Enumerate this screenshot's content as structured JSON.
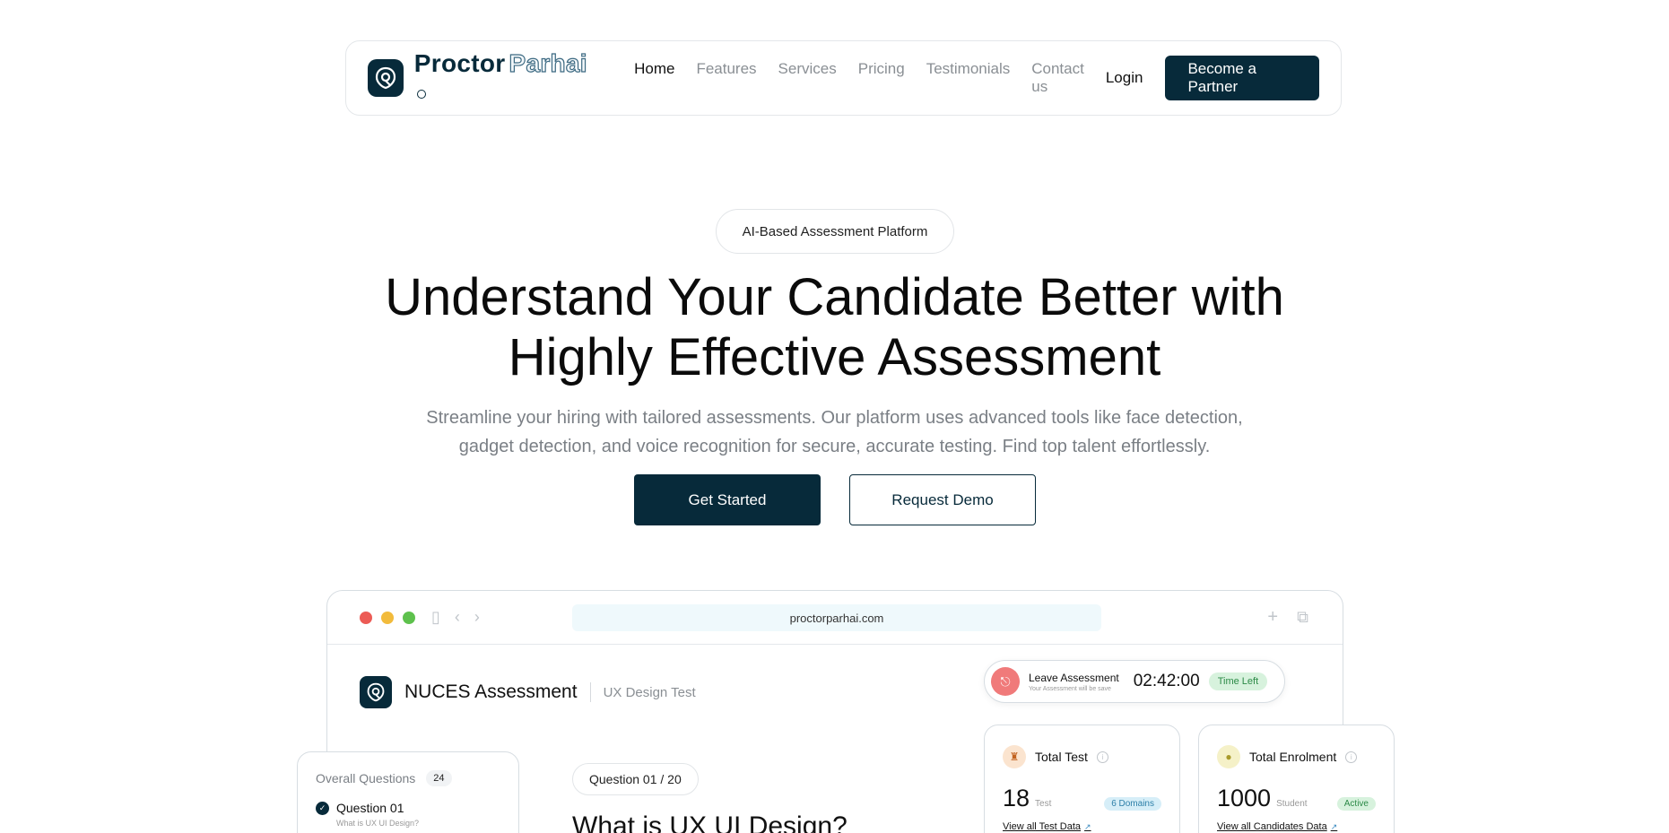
{
  "brand": {
    "name_dark": "Proctor",
    "name_light": "Parhai"
  },
  "nav": {
    "links": [
      "Home",
      "Features",
      "Services",
      "Pricing",
      "Testimonials",
      "Contact us"
    ],
    "login": "Login",
    "partner_button": "Become a Partner"
  },
  "hero": {
    "badge": "AI-Based Assessment Platform",
    "title_line1": "Understand Your Candidate Better with",
    "title_line2": "Highly Effective Assessment",
    "subtitle_line1": "Streamline your hiring with tailored assessments. Our platform uses advanced tools like face detection,",
    "subtitle_line2": "gadget detection, and voice recognition for secure, accurate testing. Find top talent effortlessly.",
    "primary_button": "Get Started",
    "secondary_button": "Request Demo"
  },
  "browser": {
    "url": "proctorparhai.com",
    "dot_colors": [
      "#ec5b55",
      "#f2bb3c",
      "#5ec14d"
    ]
  },
  "app": {
    "title": "NUCES Assessment",
    "subtitle": "UX Design Test",
    "question_pill": "Question 01 / 20",
    "question_title": "What is UX UI Design?"
  },
  "overall": {
    "label": "Overall Questions",
    "count": "24",
    "item_label": "Question 01",
    "item_sub": "What is UX UI Design?"
  },
  "timer": {
    "leave_label": "Leave Assessment",
    "leave_sub": "Your Assessment will be save",
    "time": "02:42:00",
    "time_left": "Time Left"
  },
  "stats": [
    {
      "title": "Total Test",
      "value": "18",
      "unit": "Test",
      "tag": "6 Domains",
      "link": "View all Test Data",
      "icon": "trophy-icon",
      "icon_bg": "#fbe4cf",
      "tag_bg": "#d6eef8",
      "tag_color": "#2d7fa8"
    },
    {
      "title": "Total Enrolment",
      "value": "1000",
      "unit": "Student",
      "tag": "Active",
      "link": "View all Candidates Data",
      "icon": "user-icon",
      "icon_bg": "#f5f1c8",
      "tag_bg": "#d7f2dd",
      "tag_color": "#2c8a47"
    }
  ]
}
